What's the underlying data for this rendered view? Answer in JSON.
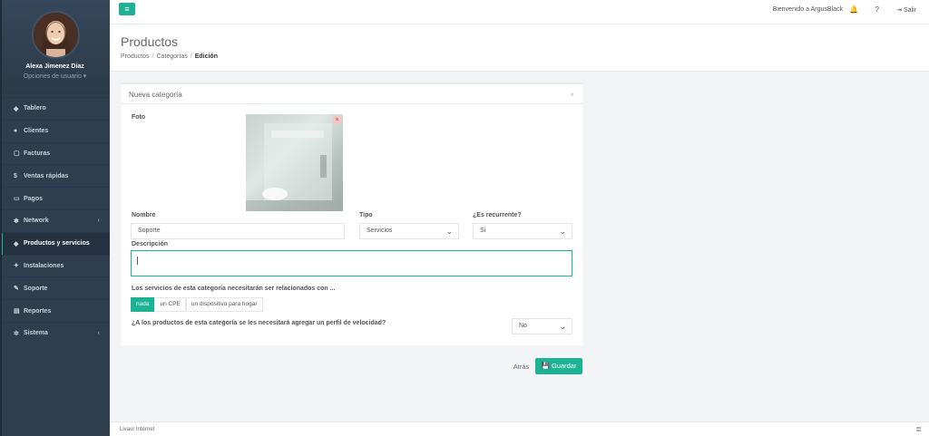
{
  "user": {
    "name": "Alexa Jimenez Díaz",
    "options_label": "Opciones de usuario ▾"
  },
  "sidebar": {
    "items": [
      {
        "icon": "dashboard-icon",
        "glyph": "◆",
        "label": "Tablero"
      },
      {
        "icon": "users-icon",
        "glyph": "●",
        "label": "Clientes"
      },
      {
        "icon": "file-icon",
        "glyph": "▢",
        "label": "Facturas"
      },
      {
        "icon": "dollar-icon",
        "glyph": "$",
        "label": "Ventas rápidas"
      },
      {
        "icon": "card-icon",
        "glyph": "▭",
        "label": "Pagos"
      },
      {
        "icon": "network-icon",
        "glyph": "✱",
        "label": "Network"
      },
      {
        "icon": "tag-icon",
        "glyph": "◆",
        "label": "Productos y servicios"
      },
      {
        "icon": "plug-icon",
        "glyph": "✦",
        "label": "Instalaciones"
      },
      {
        "icon": "wrench-icon",
        "glyph": "✎",
        "label": "Soporte"
      },
      {
        "icon": "chart-icon",
        "glyph": "▤",
        "label": "Reportes"
      },
      {
        "icon": "cogs-icon",
        "glyph": "✲",
        "label": "Sistema"
      }
    ],
    "active_index": 6
  },
  "topbar": {
    "menu_glyph": "≡",
    "welcome": "Bienvenido a ArgusBlack",
    "bell_glyph": "🔔",
    "help_glyph": "?",
    "logout_label": "⇥ Salir"
  },
  "page": {
    "title": "Productos",
    "breadcrumb": [
      "Productos",
      "Categorías",
      "Edición"
    ]
  },
  "panel": {
    "title": "Nueva categoría",
    "close_glyph": "×",
    "photo_label": "Foto",
    "remove_glyph": "×",
    "name_label": "Nombre",
    "name_value": "Soporte",
    "type_label": "Tipo",
    "type_value": "Servicios",
    "recurrent_label": "¿Es recurrente?",
    "recurrent_value": "Si",
    "description_label": "Descripción",
    "relation_label": "Los servicios de esta categoría necesitarán ser relacionados con ...",
    "relation_options": [
      "nada",
      "un CPE",
      "un dispositivo para hogar"
    ],
    "speed_label": "¿A los productos de esta categoría se les necesitará agregar un perfil de velocidad?",
    "speed_value": "No"
  },
  "actions": {
    "back_label": "Atrás",
    "save_label": "💾 Guardar"
  },
  "footer": {
    "text": "Livaur Internet",
    "icon_glyph": "≣"
  }
}
